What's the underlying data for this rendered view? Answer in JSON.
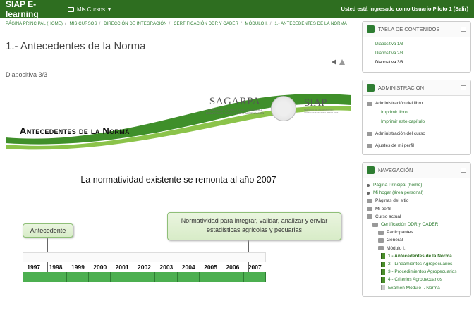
{
  "topbar": {
    "brand": "SIAP E-learning",
    "my_courses": "Mis Cursos",
    "login_text": "Usted está ingresado como Usuario Piloto 1 (Salir)"
  },
  "breadcrumb": [
    "PÁGINA PRINCIPAL (HOME)",
    "MIS CURSOS",
    "DIRECCIÓN DE INTEGRACIÓN",
    "CERTIFICACIÓN DDR Y CADER",
    "MÓDULO I.",
    "1.- ANTECEDENTES DE LA NORMA"
  ],
  "page_title": "1.- Antecedentes de la Norma",
  "slide_label": "Diapositiva 3/3",
  "slide": {
    "sagarpa": "SAGARPA",
    "sagarpa_sub": "SECRETARÍA DE AGRICULTURA, GANADERÍA, DESARROLLO RURAL, PESCA Y ALIMENTACIÓN",
    "siap": "SIAP",
    "siap_sub": "SERVICIO DE INFORMACIÓN AGROALIMENTARIA Y PESQUERA",
    "title": "Antecedentes de la Norma",
    "statement": "La normatividad existente se remonta al año 2007",
    "bubble_left": "Antecedente",
    "bubble_right": "Normatividad para    integrar, validar, analizar   y enviar estadísticas agrícolas y pecuarias",
    "years": [
      "1997",
      "1998",
      "1999",
      "2000",
      "2001",
      "2002",
      "2003",
      "2004",
      "2005",
      "2006",
      "2007"
    ]
  },
  "sidebar": {
    "toc": {
      "title": "TABLA DE CONTENIDOS",
      "items": [
        "Diapositiva 1/3",
        "Diapositiva 2/3",
        "Diapositiva 3/3"
      ]
    },
    "admin": {
      "title": "ADMINISTRACIÓN",
      "book_admin": "Administración del libro",
      "print_book": "Imprimir libro",
      "print_chapter": "Imprimir este capítulo",
      "course_admin": "Administración del curso",
      "profile_settings": "Ajustes de mi perfil"
    },
    "nav": {
      "title": "NAVEGACIÓN",
      "items": [
        "Página Principal (home)",
        "Mi hogar (área personal)",
        "Páginas del sitio",
        "Mi perfil",
        "Curso actual",
        "Certificación DDR y CADER",
        "Participantes",
        "General",
        "Módulo I.",
        "1.- Antecedentes de la Norma",
        "2.- Lineamientos Agropecuarios",
        "3.- Procedimientos Agropecuarios",
        "4.- Criterios Agropecuarios",
        "Examen Módulo I. Norma"
      ]
    }
  },
  "colors": {
    "brand_green": "#2e6e20",
    "link_green": "#2e7d32",
    "timeline_green": "#4caf50"
  }
}
